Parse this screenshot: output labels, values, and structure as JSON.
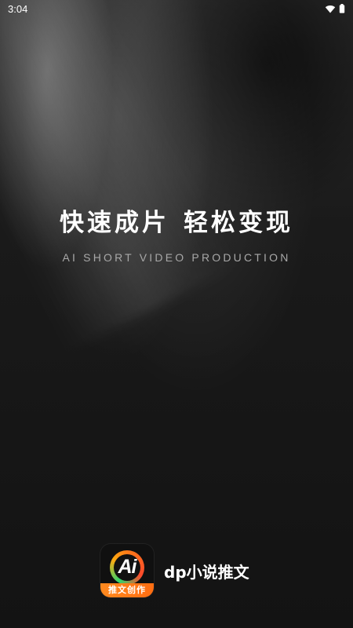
{
  "status_bar": {
    "time": "3:04"
  },
  "splash": {
    "headline_left": "快速成片",
    "headline_right": "轻松变现",
    "subtitle": "AI SHORT VIDEO PRODUCTION"
  },
  "app": {
    "icon_text": "Ai",
    "icon_label": "推文创作",
    "name": "dp小说推文"
  },
  "colors": {
    "background": "#151515",
    "accent": "#ff7a18",
    "green_accent": "#32d46c",
    "text": "#ffffff",
    "subtitle_text": "#a8a8a8"
  },
  "icons": [
    "wifi-icon",
    "battery-icon",
    "app-logo-icon"
  ]
}
